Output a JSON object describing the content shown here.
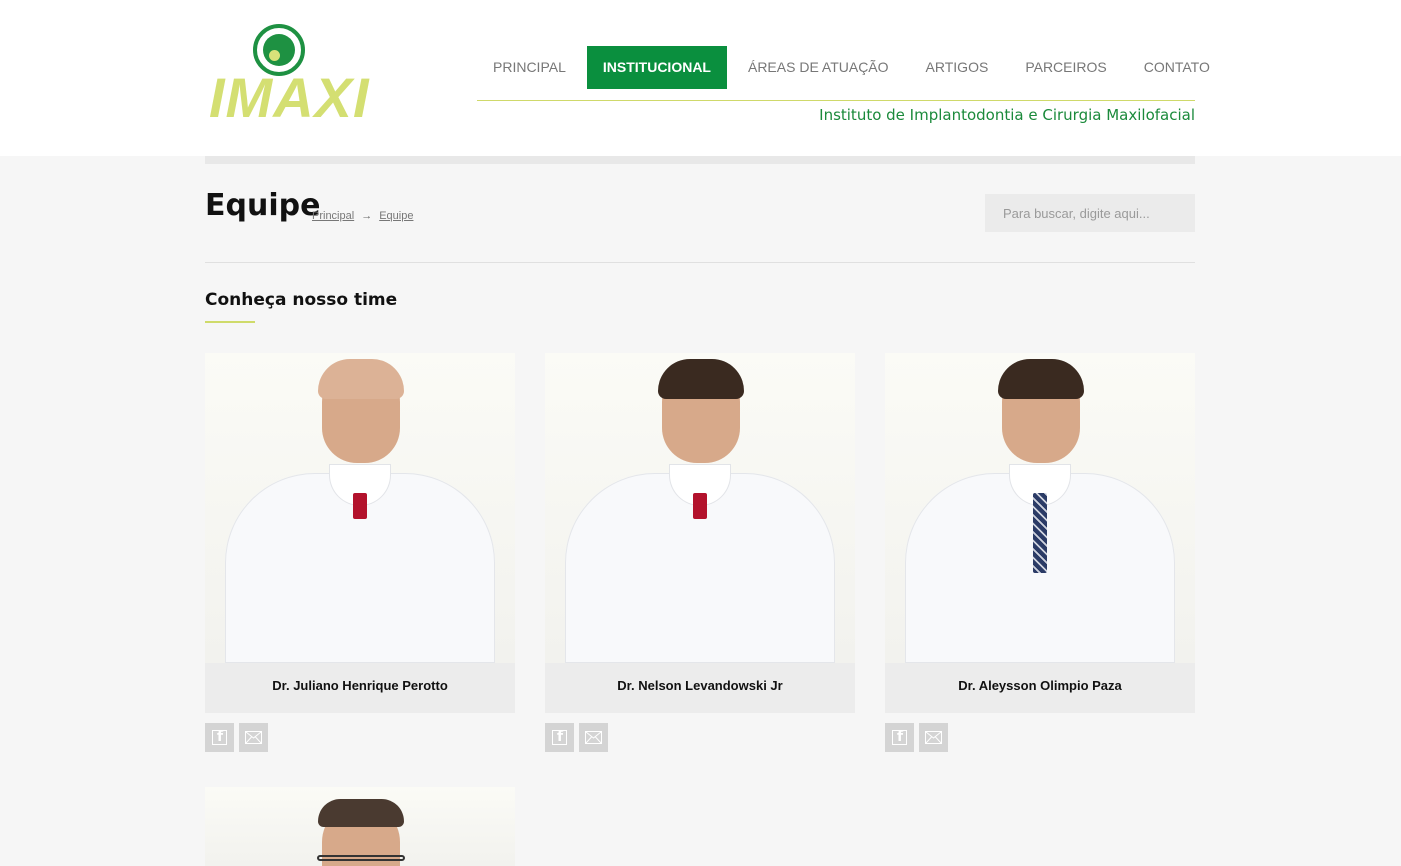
{
  "header": {
    "logo_text": "IMAXI",
    "tagline": "Instituto de Implantodontia e Cirurgia Maxilofacial",
    "nav": [
      {
        "label": "PRINCIPAL",
        "active": false
      },
      {
        "label": "INSTITUCIONAL",
        "active": true
      },
      {
        "label": "ÁREAS DE ATUAÇÃO",
        "active": false
      },
      {
        "label": "ARTIGOS",
        "active": false
      },
      {
        "label": "PARCEIROS",
        "active": false
      },
      {
        "label": "CONTATO",
        "active": false
      }
    ]
  },
  "page": {
    "title": "Equipe",
    "breadcrumb": {
      "home": "Principal",
      "separator": "→",
      "current": "Equipe"
    },
    "search_placeholder": "Para buscar, digite aqui..."
  },
  "section": {
    "title": "Conheça nosso time"
  },
  "team": [
    {
      "name": "Dr. Juliano Henrique Perotto",
      "photo_icon": "doctor-photo"
    },
    {
      "name": "Dr. Nelson Levandowski Jr",
      "photo_icon": "doctor-photo"
    },
    {
      "name": "Dr. Aleysson Olimpio Paza",
      "photo_icon": "doctor-photo"
    }
  ],
  "colors": {
    "brand_green": "#0a8f3e",
    "brand_lime": "#d4df72",
    "tagline_green": "#1b8a3b"
  }
}
